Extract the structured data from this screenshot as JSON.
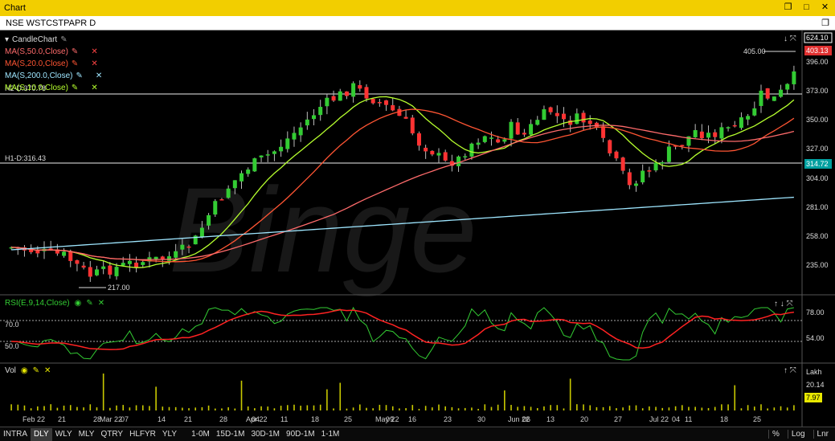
{
  "window": {
    "title": "Chart",
    "controls": [
      "restore-icon",
      "maximize-icon",
      "close-icon"
    ]
  },
  "symbol_bar": {
    "symbol": "NSE WSTCSTPAPR D",
    "restore_icon": "restore-icon"
  },
  "legend": {
    "candle": "CandleChart",
    "mas": [
      {
        "label": "MA(S,50.0,Close)",
        "color": "#ff6b6b"
      },
      {
        "label": "MA(S,20.0,Close)",
        "color": "#ff5533"
      },
      {
        "label": "MA(S,200.0,Close)",
        "color": "#9ee6ff"
      },
      {
        "label": "MA(S,10.0,Close)",
        "color": "#b6ff2e"
      }
    ]
  },
  "price_panel": {
    "h2_label": "H2-D:370.78",
    "h1_label": "H1-D:316.43",
    "high_marker": "405.00",
    "low_marker": "217.00",
    "watermark": "Binge",
    "axis": {
      "top_value": "624.10",
      "last_price": "403.13",
      "h1_value": "314.72",
      "ticks": [
        "396.00",
        "373.00",
        "350.00",
        "327.00",
        "304.00",
        "281.00",
        "258.00",
        "235.00"
      ]
    }
  },
  "rsi_panel": {
    "label": "RSI(E,9,14,Close)",
    "levels": [
      "70.0",
      "50.0"
    ],
    "axis_ticks": [
      "78.00",
      "54.00"
    ]
  },
  "vol_panel": {
    "label": "Vol",
    "unit": "Lakh",
    "axis_ticks": [
      "20.14"
    ],
    "last_vol": "7.97"
  },
  "x_axis": {
    "labels": [
      "Feb 22",
      "21",
      "28",
      "Mar 22",
      "07",
      "14",
      "21",
      "28",
      "Apr 22",
      "04",
      "11",
      "18",
      "25",
      "May 22",
      "09",
      "16",
      "23",
      "30",
      "Jun 22",
      "06",
      "13",
      "20",
      "27",
      "Jul 22",
      "04",
      "11",
      "18",
      "25"
    ]
  },
  "bottom_bar": {
    "intervals": [
      "INTRA",
      "DLY",
      "WLY",
      "MLY",
      "QTRY",
      "HLFYR",
      "YLY"
    ],
    "active": "DLY",
    "ranges": [
      "1-0M",
      "15D-1M",
      "30D-1M",
      "90D-1M",
      "1-1M"
    ],
    "right": [
      "%",
      "Log",
      "Lnr"
    ]
  },
  "colors": {
    "title_bg": "#f2ce00",
    "up": "#33cc33",
    "down": "#ff3333",
    "rsi": "#33cc33",
    "rsi_signal": "#ff2222",
    "vol": "#c8c800"
  }
}
